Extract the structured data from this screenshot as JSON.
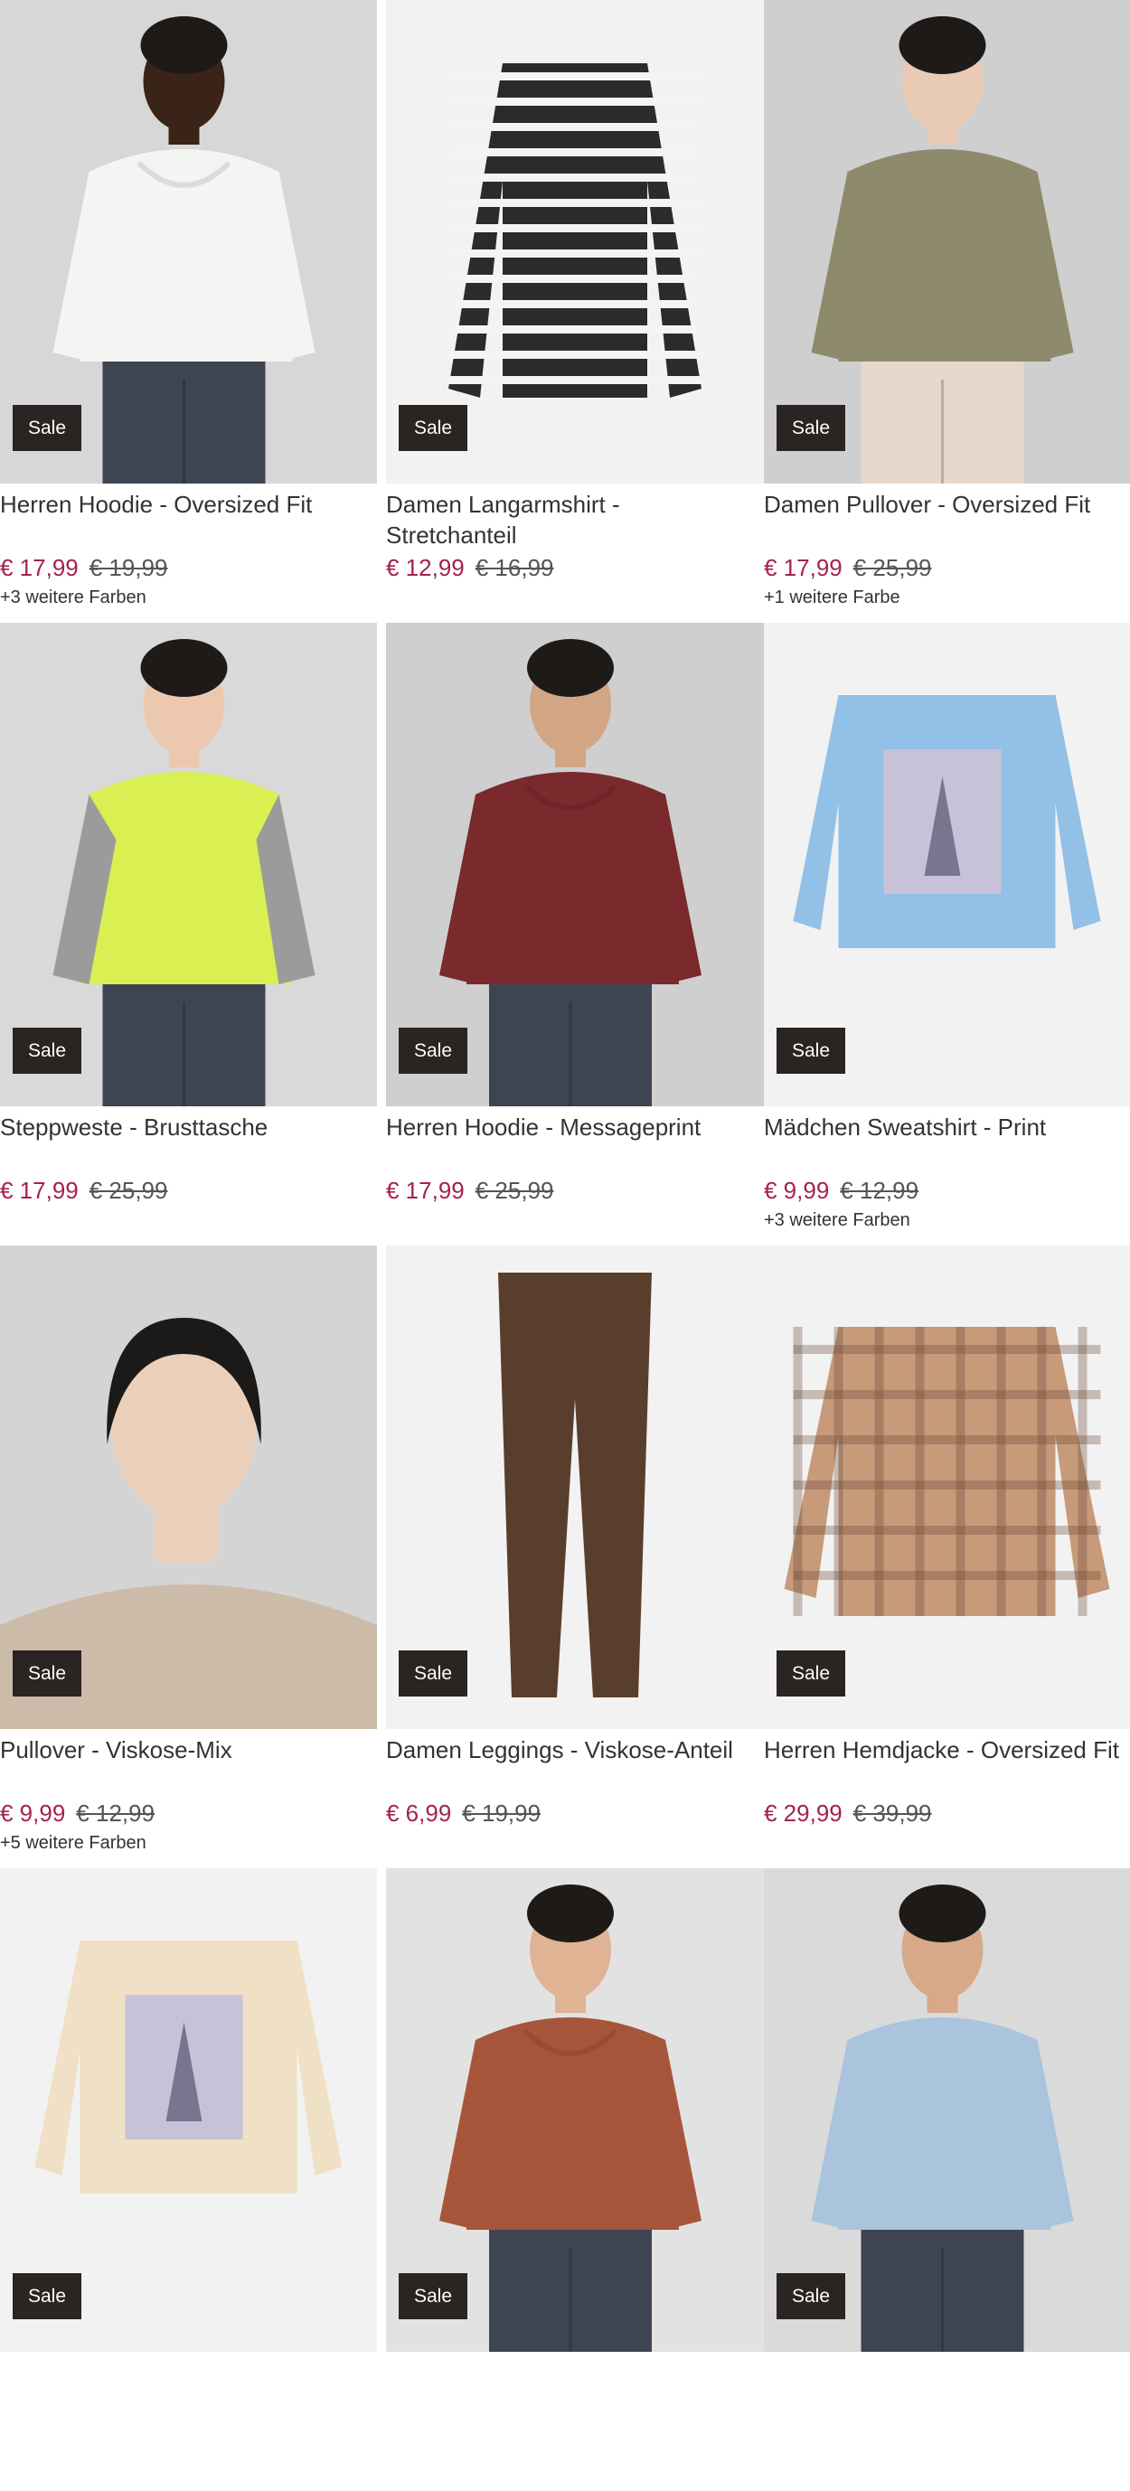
{
  "products": [
    {
      "title": "Herren Hoodie - Oversized Fit",
      "price": "€ 17,99",
      "old_price": "€ 19,99",
      "colors": "+3 weitere Farben",
      "badge": "Sale",
      "bg": "#d7d7d7",
      "garment": "#f4f4f2",
      "skin": "#3a2418",
      "kind": "hoodie-model"
    },
    {
      "title": "Damen Langarmshirt - Stretchanteil",
      "price": "€ 12,99",
      "old_price": "€ 16,99",
      "colors": "",
      "badge": "Sale",
      "bg": "#f2f2f2",
      "garment": "#2b2b2b",
      "skin": "",
      "kind": "striped"
    },
    {
      "title": "Damen Pullover - Oversized Fit",
      "price": "€ 17,99",
      "old_price": "€ 25,99",
      "colors": "+1 weitere Farbe",
      "badge": "Sale",
      "bg": "#cfcfcf",
      "garment": "#8e8a6c",
      "skin": "#e9cbb5",
      "kind": "sweater-model"
    },
    {
      "title": "Steppweste - Brusttasche",
      "price": "€ 17,99",
      "old_price": "€ 25,99",
      "colors": "",
      "badge": "Sale",
      "bg": "#d9d9d9",
      "garment": "#d9ef52",
      "skin": "#ecc9ae",
      "kind": "vest-model"
    },
    {
      "title": "Herren Hoodie - Messageprint",
      "price": "€ 17,99",
      "old_price": "€ 25,99",
      "colors": "",
      "badge": "Sale",
      "bg": "#cfcfcf",
      "garment": "#7a2a2c",
      "skin": "#d2a584",
      "kind": "hoodie-model"
    },
    {
      "title": "Mädchen Sweatshirt - Print",
      "price": "€ 9,99",
      "old_price": "€ 12,99",
      "colors": "+3 weitere Farben",
      "badge": "Sale",
      "bg": "#f2f2f2",
      "garment": "#92c0e6",
      "skin": "",
      "kind": "sweatshirt-flat"
    },
    {
      "title": "Pullover - Viskose-Mix",
      "price": "€ 9,99",
      "old_price": "€ 12,99",
      "colors": "+5 weitere Farben",
      "badge": "Sale",
      "bg": "#d4d4d4",
      "garment": "#cdbba9",
      "skin": "#ead0bb",
      "kind": "portrait"
    },
    {
      "title": "Damen Leggings - Viskose-Anteil",
      "price": "€ 6,99",
      "old_price": "€ 19,99",
      "colors": "",
      "badge": "Sale",
      "bg": "#f2f2f2",
      "garment": "#5a3e2d",
      "skin": "",
      "kind": "leggings"
    },
    {
      "title": "Herren Hemdjacke - Oversized Fit",
      "price": "€ 29,99",
      "old_price": "€ 39,99",
      "colors": "",
      "badge": "Sale",
      "bg": "#f2f2f2",
      "garment": "#c79a7a",
      "skin": "",
      "kind": "jacket-flat"
    },
    {
      "title": "",
      "price": "",
      "old_price": "",
      "colors": "",
      "badge": "Sale",
      "bg": "#f2f2f2",
      "garment": "#efe0c6",
      "skin": "",
      "kind": "sweatshirt-flat"
    },
    {
      "title": "",
      "price": "",
      "old_price": "",
      "colors": "",
      "badge": "Sale",
      "bg": "#e2e2e2",
      "garment": "#a7553a",
      "skin": "#e0b394",
      "kind": "hoodie-model"
    },
    {
      "title": "",
      "price": "",
      "old_price": "",
      "colors": "",
      "badge": "Sale",
      "bg": "#dadada",
      "garment": "#a9c4dc",
      "skin": "#d8a988",
      "kind": "sweater-model"
    }
  ]
}
